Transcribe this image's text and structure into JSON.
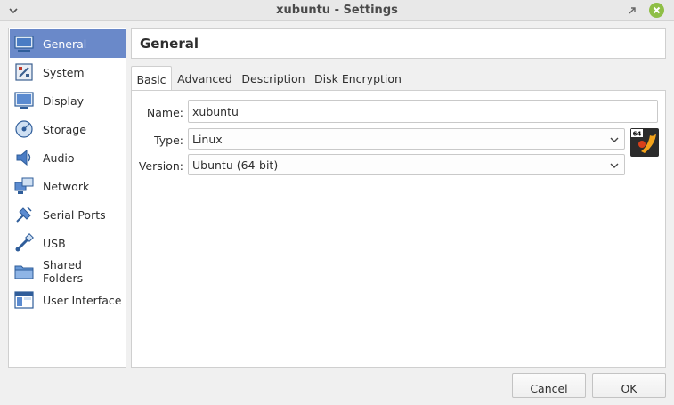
{
  "window": {
    "title": "xubuntu - Settings"
  },
  "sidebar": {
    "items": [
      {
        "label": "General",
        "icon": "general-icon"
      },
      {
        "label": "System",
        "icon": "system-icon"
      },
      {
        "label": "Display",
        "icon": "display-icon"
      },
      {
        "label": "Storage",
        "icon": "storage-icon"
      },
      {
        "label": "Audio",
        "icon": "audio-icon"
      },
      {
        "label": "Network",
        "icon": "network-icon"
      },
      {
        "label": "Serial Ports",
        "icon": "serial-ports-icon"
      },
      {
        "label": "USB",
        "icon": "usb-icon"
      },
      {
        "label": "Shared Folders",
        "icon": "shared-folders-icon"
      },
      {
        "label": "User Interface",
        "icon": "user-interface-icon"
      }
    ],
    "selected": "General"
  },
  "header": {
    "title": "General"
  },
  "tabs": [
    {
      "label": "Basic",
      "active": true
    },
    {
      "label": "Advanced",
      "active": false
    },
    {
      "label": "Description",
      "active": false
    },
    {
      "label": "Disk Encryption",
      "active": false
    }
  ],
  "form": {
    "name_label": "Name:",
    "name_value": "xubuntu",
    "type_label": "Type:",
    "type_value": "Linux",
    "version_label": "Version:",
    "version_value": "Ubuntu (64-bit)",
    "os_badge": "64"
  },
  "buttons": {
    "cancel": "Cancel",
    "ok": "OK"
  },
  "colors": {
    "selected_bg": "#6a89c9",
    "close_button": "#8fbf46",
    "window_bg": "#f0f0f0"
  }
}
